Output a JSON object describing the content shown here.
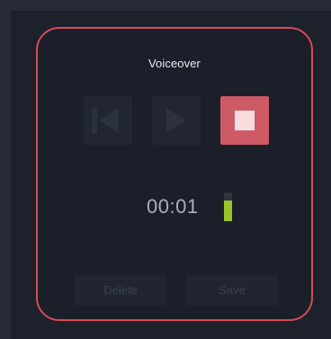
{
  "recorder": {
    "title": "Voiceover",
    "timer": "00:01",
    "level_meter_fraction": 0.72,
    "delete_label": "Delete",
    "save_label": "Save",
    "controls": {
      "previous": "skip-back-icon",
      "play": "play-icon",
      "stop": "stop-icon"
    }
  },
  "colors": {
    "accent_border": "#d74b57",
    "stop_button": "#ce5a66",
    "meter_level": "#9ac22a",
    "background": "#1b1f29"
  }
}
